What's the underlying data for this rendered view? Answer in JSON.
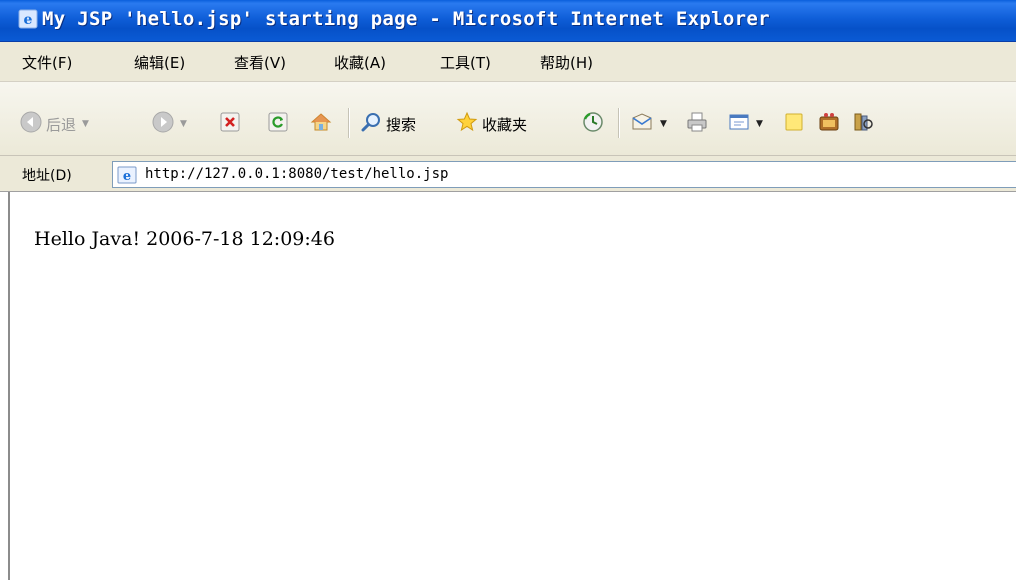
{
  "window": {
    "title": "My JSP 'hello.jsp' starting page - Microsoft Internet Explorer"
  },
  "menu": {
    "items": [
      "文件(F)",
      "编辑(E)",
      "查看(V)",
      "收藏(A)",
      "工具(T)",
      "帮助(H)"
    ]
  },
  "toolbar": {
    "back_label": "后退",
    "search_label": "搜索",
    "favorites_label": "收藏夹",
    "icons": [
      "back-icon",
      "forward-icon",
      "stop-icon",
      "refresh-icon",
      "home-icon",
      "search-icon",
      "favorites-icon",
      "history-icon",
      "mail-icon",
      "print-icon",
      "edit-icon",
      "discuss-icon",
      "messenger-icon",
      "research-icon"
    ]
  },
  "address": {
    "label": "地址(D)",
    "url": "http://127.0.0.1:8080/test/hello.jsp"
  },
  "page": {
    "text": "Hello Java! 2006-7-18 12:09:46"
  },
  "colors": {
    "titlebar_blue": "#0a5fdc",
    "chrome_beige": "#ece9d8"
  }
}
